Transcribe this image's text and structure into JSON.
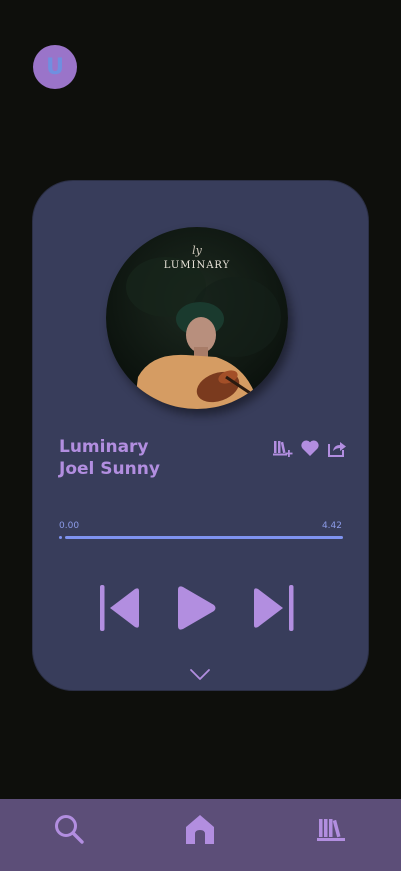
{
  "profile": {
    "initial": "U"
  },
  "album": {
    "cover_title": "LUMINARY",
    "cover_signature": "ly"
  },
  "track": {
    "title": "Luminary",
    "artist": "Joel Sunny"
  },
  "progress": {
    "current": "0.00",
    "duration": "4.42",
    "fraction": 0.0
  },
  "actions": [
    "add-to-playlist-icon",
    "heart-icon",
    "share-icon"
  ],
  "controls": [
    "skip-previous-icon",
    "play-icon",
    "skip-next-icon"
  ],
  "nav": [
    "search-icon",
    "home-icon",
    "library-icon"
  ],
  "colors": {
    "background": "#0e0f0c",
    "card": "#383d5b",
    "accent": "#b28ee0",
    "progress": "#7f93f0",
    "nav": "#5c4e78",
    "avatar": "#9a74c9"
  }
}
